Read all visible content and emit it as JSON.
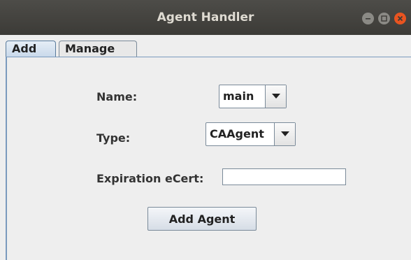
{
  "window": {
    "title": "Agent Handler",
    "buttons": [
      "minimize-icon",
      "maximize-icon",
      "close-icon"
    ],
    "accent_close": "#e95420"
  },
  "tabs": [
    {
      "label": "Add",
      "selected": true
    },
    {
      "label": "Manage",
      "selected": false
    }
  ],
  "form": {
    "name_label": "Name:",
    "name_value": "main",
    "type_label": "Type:",
    "type_value": "CAAgent",
    "expiration_label": "Expiration eCert:",
    "expiration_value": "",
    "submit_label": "Add Agent"
  }
}
